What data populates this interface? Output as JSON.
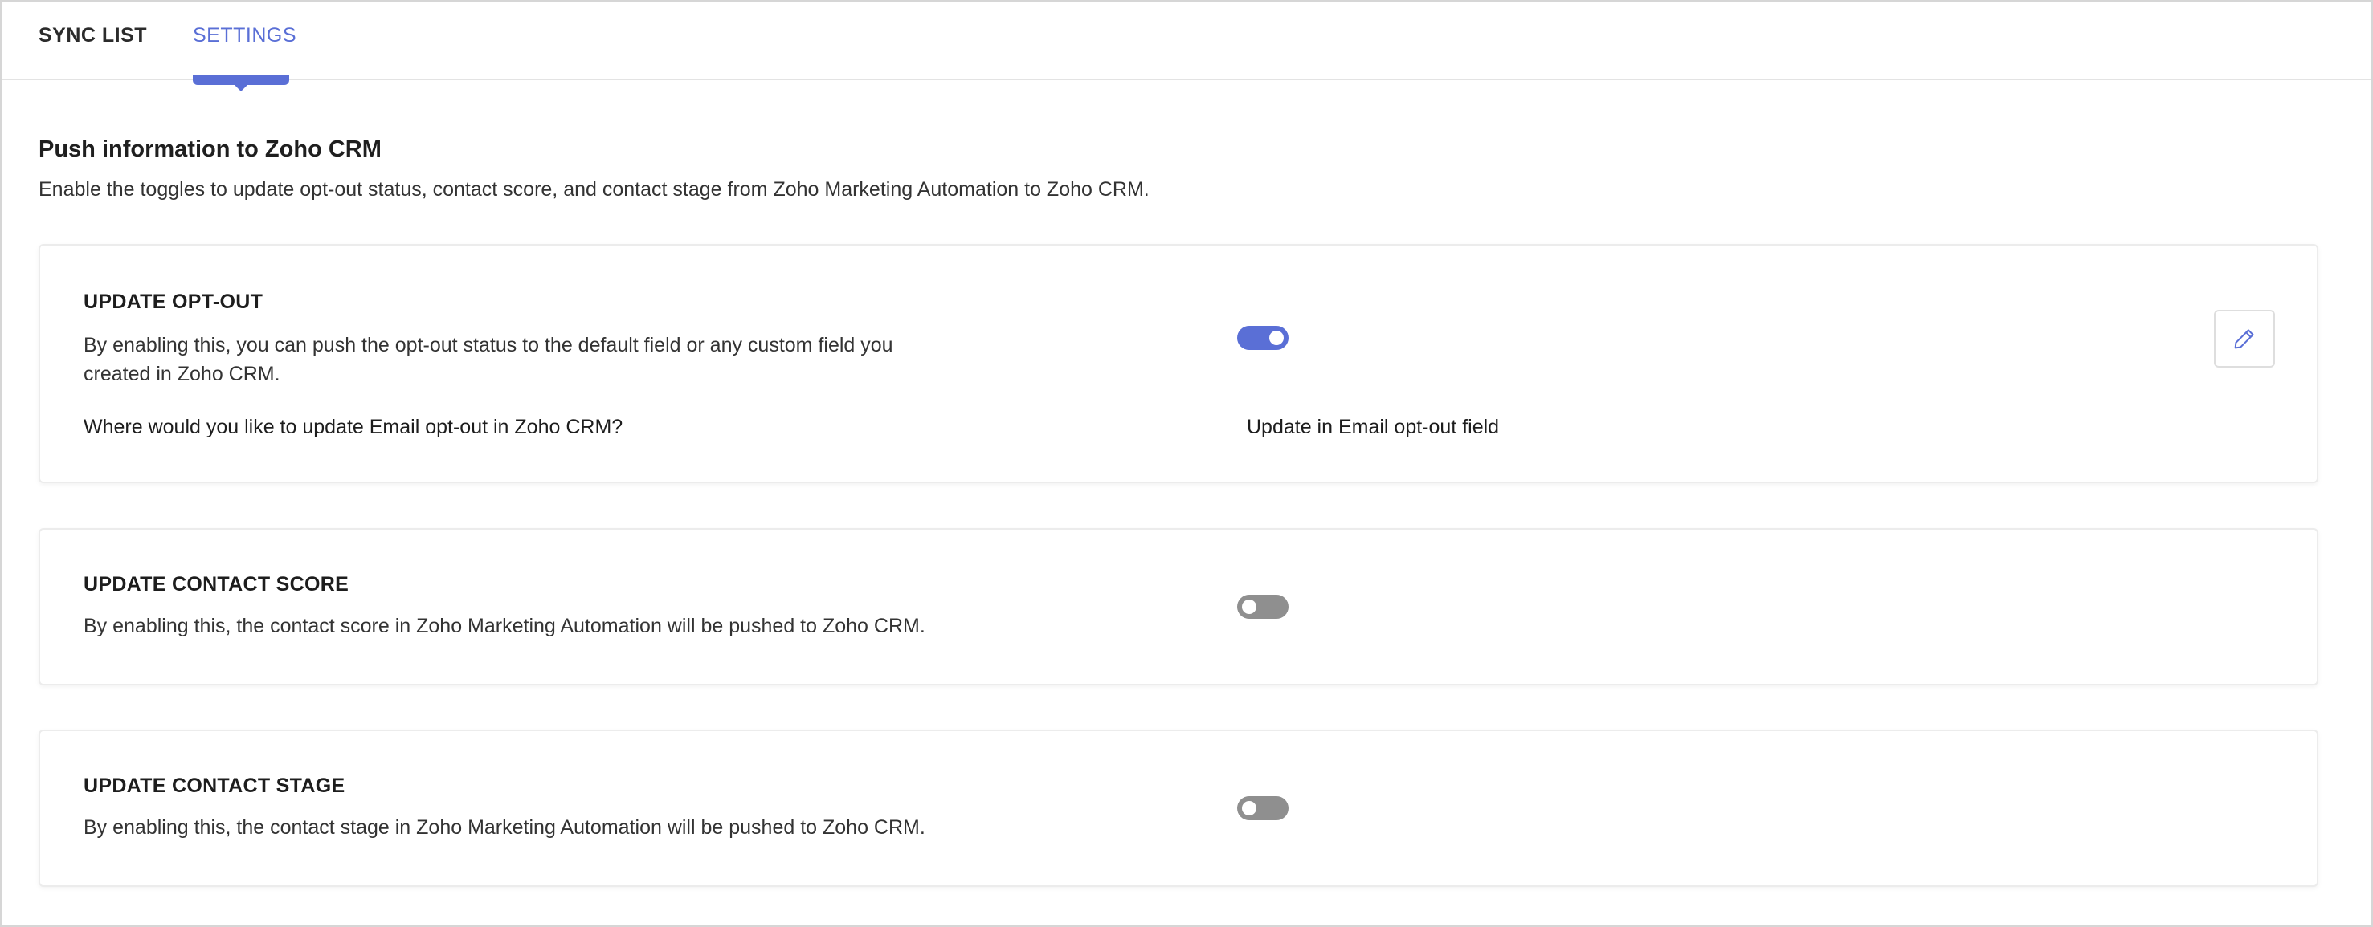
{
  "tabs": [
    {
      "label": "SYNC LIST",
      "active": false
    },
    {
      "label": "SETTINGS",
      "active": true
    }
  ],
  "section": {
    "title": "Push information to Zoho CRM",
    "description": "Enable the toggles to update opt-out status, contact score, and contact stage from Zoho Marketing Automation to Zoho CRM."
  },
  "cards": [
    {
      "title": "UPDATE OPT-OUT",
      "description": "By enabling this, you can push the opt-out status to the default field or any custom field you created in Zoho CRM.",
      "enabled": true,
      "question": "Where would you like to update Email opt-out in Zoho CRM?",
      "answer": "Update in Email opt-out field",
      "edit_icon": "pencil-icon"
    },
    {
      "title": "UPDATE CONTACT SCORE",
      "description": "By enabling this, the contact score in Zoho Marketing Automation will be pushed to Zoho CRM.",
      "enabled": false
    },
    {
      "title": "UPDATE CONTACT STAGE",
      "description": "By enabling this, the contact stage in Zoho Marketing Automation will be pushed to Zoho CRM.",
      "enabled": false
    }
  ],
  "colors": {
    "accent": "#5a6fd6",
    "toggle_off": "#8f8f8f",
    "border": "#ececec"
  }
}
